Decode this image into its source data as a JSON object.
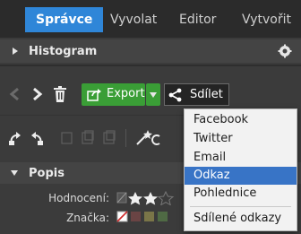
{
  "tabs": [
    {
      "label": "Správce",
      "active": true
    },
    {
      "label": "Vyvolat",
      "active": false
    },
    {
      "label": "Editor",
      "active": false
    },
    {
      "label": "Vytvořit",
      "active": false
    }
  ],
  "histogram_panel": {
    "title": "Histogram"
  },
  "toolbar": {
    "export_label": "Export",
    "share_label": "Sdílet"
  },
  "share_menu": {
    "items": [
      "Facebook",
      "Twitter",
      "Email",
      "Odkaz",
      "Pohlednice",
      "Sdílené odkazy"
    ],
    "selected": "Odkaz"
  },
  "popis_panel": {
    "title": "Popis",
    "rating_label": "Hodnocení:",
    "rating_stars": 2,
    "label_label": "Značka:"
  },
  "colors": {
    "accent_tab": "#2f86d8",
    "export_green": "#3a9e36",
    "menu_selected": "#3874c6"
  }
}
